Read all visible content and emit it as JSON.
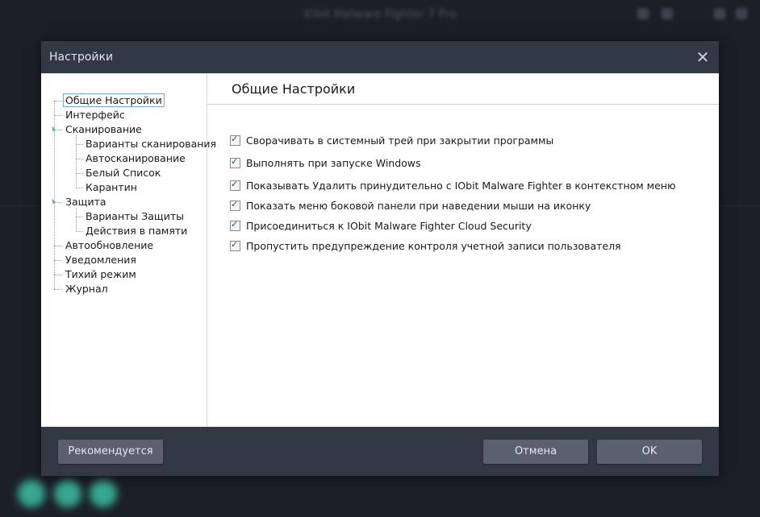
{
  "background": {
    "app_title": "IObit Malware Fighter 7 Pro"
  },
  "dialog": {
    "title": "Настройки",
    "tree": [
      {
        "label": "Общие Настройки",
        "level": 0,
        "selected": true
      },
      {
        "label": "Интерфейс",
        "level": 0
      },
      {
        "label": "Сканирование",
        "level": 0,
        "expanded": true
      },
      {
        "label": "Варианты сканирования",
        "level": 1
      },
      {
        "label": "Автосканирование",
        "level": 1
      },
      {
        "label": "Белый Список",
        "level": 1
      },
      {
        "label": "Карантин",
        "level": 1
      },
      {
        "label": "Защита",
        "level": 0,
        "expanded": true
      },
      {
        "label": "Варианты Защиты",
        "level": 1
      },
      {
        "label": "Действия в памяти",
        "level": 1
      },
      {
        "label": "Автообновление",
        "level": 0
      },
      {
        "label": "Уведомления",
        "level": 0
      },
      {
        "label": "Тихий режим",
        "level": 0
      },
      {
        "label": "Журнал",
        "level": 0
      }
    ],
    "panel": {
      "title": "Общие Настройки",
      "options": [
        {
          "label": "Сворачивать в системный трей при закрытии программы",
          "checked": true
        },
        {
          "label": "Выполнять при запуске Windows",
          "checked": true
        },
        {
          "label": "Показывать Удалить принудительно с IObit Malware Fighter в контекстном меню",
          "checked": true
        },
        {
          "label": "Показать меню боковой панели при наведении мыши на иконку",
          "checked": true
        },
        {
          "label": "Присоединиться к IObit Malware Fighter Cloud Security",
          "checked": true
        },
        {
          "label": "Пропустить предупреждение контроля учетной записи пользователя",
          "checked": true
        }
      ]
    },
    "buttons": {
      "recommended": "Рекомендуется",
      "cancel": "Отмена",
      "ok": "OK"
    }
  },
  "icons": {
    "close": "close-icon",
    "expander": "expand-triangle-icon",
    "checkbox": "checkbox-checked-icon"
  },
  "colors": {
    "dialog_bg": "#323844",
    "button_bg": "#5a606c",
    "expander": "#4aa8d9",
    "selection_border": "#7aa3d6"
  }
}
